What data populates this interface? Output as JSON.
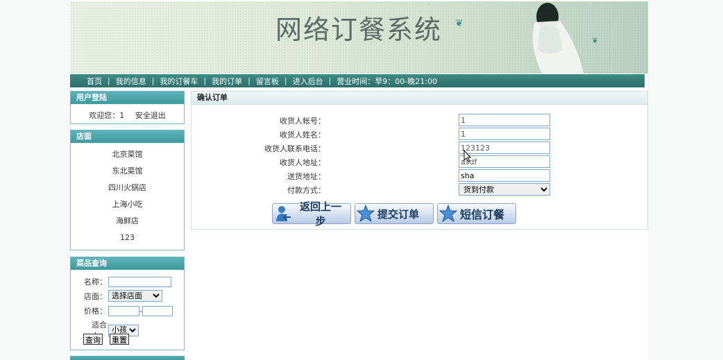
{
  "banner": {
    "title": "网络订餐系统"
  },
  "nav": {
    "items": [
      "首页",
      "我的信息",
      "我的订餐车",
      "我的订单",
      "留言板",
      "进入后台"
    ],
    "separator": "|",
    "hours": "营业时间：早9：00-晚21:00"
  },
  "login": {
    "header": "用户登陆",
    "welcome": "欢迎您：1",
    "logout": "安全退出"
  },
  "shops": {
    "header": "店面",
    "items": [
      "北京菜馆",
      "东北菜馆",
      "四川火锅店",
      "上海小吃",
      "海鲜店",
      "123"
    ]
  },
  "search": {
    "header": "菜品查询",
    "name_label": "名称：",
    "shop_label": "店面：",
    "shop_selected": "选择店面",
    "price_label": "价格：",
    "price_sep": "-",
    "target_label": "适合人：",
    "target_selected": "小孩",
    "query_btn": "查询",
    "reset_btn": "重置"
  },
  "order": {
    "header": "确认订单",
    "fields": [
      {
        "label": "收货人帐号：",
        "value": "1"
      },
      {
        "label": "收货人姓名：",
        "value": "1"
      },
      {
        "label": "收货人联系电话：",
        "value": "123123"
      },
      {
        "label": "收货人地址：",
        "value": "asdf"
      },
      {
        "label": "送货地址：",
        "value": "sha"
      }
    ],
    "payment_label": "付款方式：",
    "payment_selected": "货到付款",
    "back_btn": "返回上一步",
    "submit_btn": "提交订单",
    "sms_btn": "短信订餐"
  },
  "colors": {
    "nav_bg": "#2e6f6c",
    "box_header": "#3e9aa0",
    "box_border": "#76b6bc",
    "button_text": "#1a3a5e"
  }
}
